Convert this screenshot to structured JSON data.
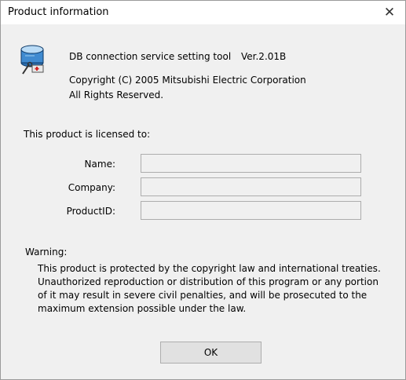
{
  "window": {
    "title": "Product information",
    "close_glyph": "✕"
  },
  "about": {
    "icon": "database-connection-icon",
    "product_line": "DB connection service setting tool",
    "version": "Ver.2.01B",
    "copyright_line": "Copyright (C) 2005 Mitsubishi Electric Corporation",
    "rights_line": "All Rights Reserved."
  },
  "license": {
    "heading": "This product is licensed to:",
    "name_label": "Name:",
    "name_value": "",
    "company_label": "Company:",
    "company_value": "",
    "productid_label": "ProductID:",
    "productid_value": ""
  },
  "warning": {
    "heading": "Warning:",
    "lines": [
      "This product is protected by the copyright law and international treaties.",
      "Unauthorized reproduction or distribution of this program or any portion",
      "of it may result in severe civil penalties, and will be prosecuted to the",
      "maximum extension possible under the law."
    ]
  },
  "buttons": {
    "ok_label": "OK"
  },
  "colors": {
    "dialog_background": "#f0f0f0",
    "titlebar_background": "#ffffff",
    "field_border": "#adadad"
  }
}
